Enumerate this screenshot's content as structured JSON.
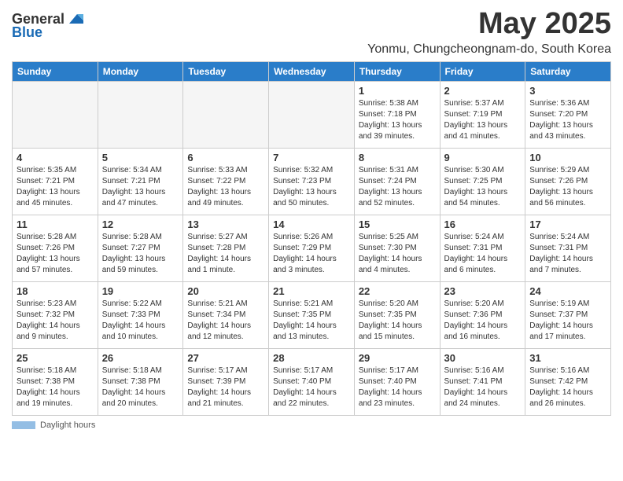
{
  "logo": {
    "general": "General",
    "blue": "Blue"
  },
  "title": "May 2025",
  "location": "Yonmu, Chungcheongnam-do, South Korea",
  "days_of_week": [
    "Sunday",
    "Monday",
    "Tuesday",
    "Wednesday",
    "Thursday",
    "Friday",
    "Saturday"
  ],
  "footer": {
    "label": "Daylight hours"
  },
  "weeks": [
    [
      {
        "day": "",
        "info": ""
      },
      {
        "day": "",
        "info": ""
      },
      {
        "day": "",
        "info": ""
      },
      {
        "day": "",
        "info": ""
      },
      {
        "day": "1",
        "info": "Sunrise: 5:38 AM\nSunset: 7:18 PM\nDaylight: 13 hours\nand 39 minutes."
      },
      {
        "day": "2",
        "info": "Sunrise: 5:37 AM\nSunset: 7:19 PM\nDaylight: 13 hours\nand 41 minutes."
      },
      {
        "day": "3",
        "info": "Sunrise: 5:36 AM\nSunset: 7:20 PM\nDaylight: 13 hours\nand 43 minutes."
      }
    ],
    [
      {
        "day": "4",
        "info": "Sunrise: 5:35 AM\nSunset: 7:21 PM\nDaylight: 13 hours\nand 45 minutes."
      },
      {
        "day": "5",
        "info": "Sunrise: 5:34 AM\nSunset: 7:21 PM\nDaylight: 13 hours\nand 47 minutes."
      },
      {
        "day": "6",
        "info": "Sunrise: 5:33 AM\nSunset: 7:22 PM\nDaylight: 13 hours\nand 49 minutes."
      },
      {
        "day": "7",
        "info": "Sunrise: 5:32 AM\nSunset: 7:23 PM\nDaylight: 13 hours\nand 50 minutes."
      },
      {
        "day": "8",
        "info": "Sunrise: 5:31 AM\nSunset: 7:24 PM\nDaylight: 13 hours\nand 52 minutes."
      },
      {
        "day": "9",
        "info": "Sunrise: 5:30 AM\nSunset: 7:25 PM\nDaylight: 13 hours\nand 54 minutes."
      },
      {
        "day": "10",
        "info": "Sunrise: 5:29 AM\nSunset: 7:26 PM\nDaylight: 13 hours\nand 56 minutes."
      }
    ],
    [
      {
        "day": "11",
        "info": "Sunrise: 5:28 AM\nSunset: 7:26 PM\nDaylight: 13 hours\nand 57 minutes."
      },
      {
        "day": "12",
        "info": "Sunrise: 5:28 AM\nSunset: 7:27 PM\nDaylight: 13 hours\nand 59 minutes."
      },
      {
        "day": "13",
        "info": "Sunrise: 5:27 AM\nSunset: 7:28 PM\nDaylight: 14 hours\nand 1 minute."
      },
      {
        "day": "14",
        "info": "Sunrise: 5:26 AM\nSunset: 7:29 PM\nDaylight: 14 hours\nand 3 minutes."
      },
      {
        "day": "15",
        "info": "Sunrise: 5:25 AM\nSunset: 7:30 PM\nDaylight: 14 hours\nand 4 minutes."
      },
      {
        "day": "16",
        "info": "Sunrise: 5:24 AM\nSunset: 7:31 PM\nDaylight: 14 hours\nand 6 minutes."
      },
      {
        "day": "17",
        "info": "Sunrise: 5:24 AM\nSunset: 7:31 PM\nDaylight: 14 hours\nand 7 minutes."
      }
    ],
    [
      {
        "day": "18",
        "info": "Sunrise: 5:23 AM\nSunset: 7:32 PM\nDaylight: 14 hours\nand 9 minutes."
      },
      {
        "day": "19",
        "info": "Sunrise: 5:22 AM\nSunset: 7:33 PM\nDaylight: 14 hours\nand 10 minutes."
      },
      {
        "day": "20",
        "info": "Sunrise: 5:21 AM\nSunset: 7:34 PM\nDaylight: 14 hours\nand 12 minutes."
      },
      {
        "day": "21",
        "info": "Sunrise: 5:21 AM\nSunset: 7:35 PM\nDaylight: 14 hours\nand 13 minutes."
      },
      {
        "day": "22",
        "info": "Sunrise: 5:20 AM\nSunset: 7:35 PM\nDaylight: 14 hours\nand 15 minutes."
      },
      {
        "day": "23",
        "info": "Sunrise: 5:20 AM\nSunset: 7:36 PM\nDaylight: 14 hours\nand 16 minutes."
      },
      {
        "day": "24",
        "info": "Sunrise: 5:19 AM\nSunset: 7:37 PM\nDaylight: 14 hours\nand 17 minutes."
      }
    ],
    [
      {
        "day": "25",
        "info": "Sunrise: 5:18 AM\nSunset: 7:38 PM\nDaylight: 14 hours\nand 19 minutes."
      },
      {
        "day": "26",
        "info": "Sunrise: 5:18 AM\nSunset: 7:38 PM\nDaylight: 14 hours\nand 20 minutes."
      },
      {
        "day": "27",
        "info": "Sunrise: 5:17 AM\nSunset: 7:39 PM\nDaylight: 14 hours\nand 21 minutes."
      },
      {
        "day": "28",
        "info": "Sunrise: 5:17 AM\nSunset: 7:40 PM\nDaylight: 14 hours\nand 22 minutes."
      },
      {
        "day": "29",
        "info": "Sunrise: 5:17 AM\nSunset: 7:40 PM\nDaylight: 14 hours\nand 23 minutes."
      },
      {
        "day": "30",
        "info": "Sunrise: 5:16 AM\nSunset: 7:41 PM\nDaylight: 14 hours\nand 24 minutes."
      },
      {
        "day": "31",
        "info": "Sunrise: 5:16 AM\nSunset: 7:42 PM\nDaylight: 14 hours\nand 26 minutes."
      }
    ]
  ]
}
